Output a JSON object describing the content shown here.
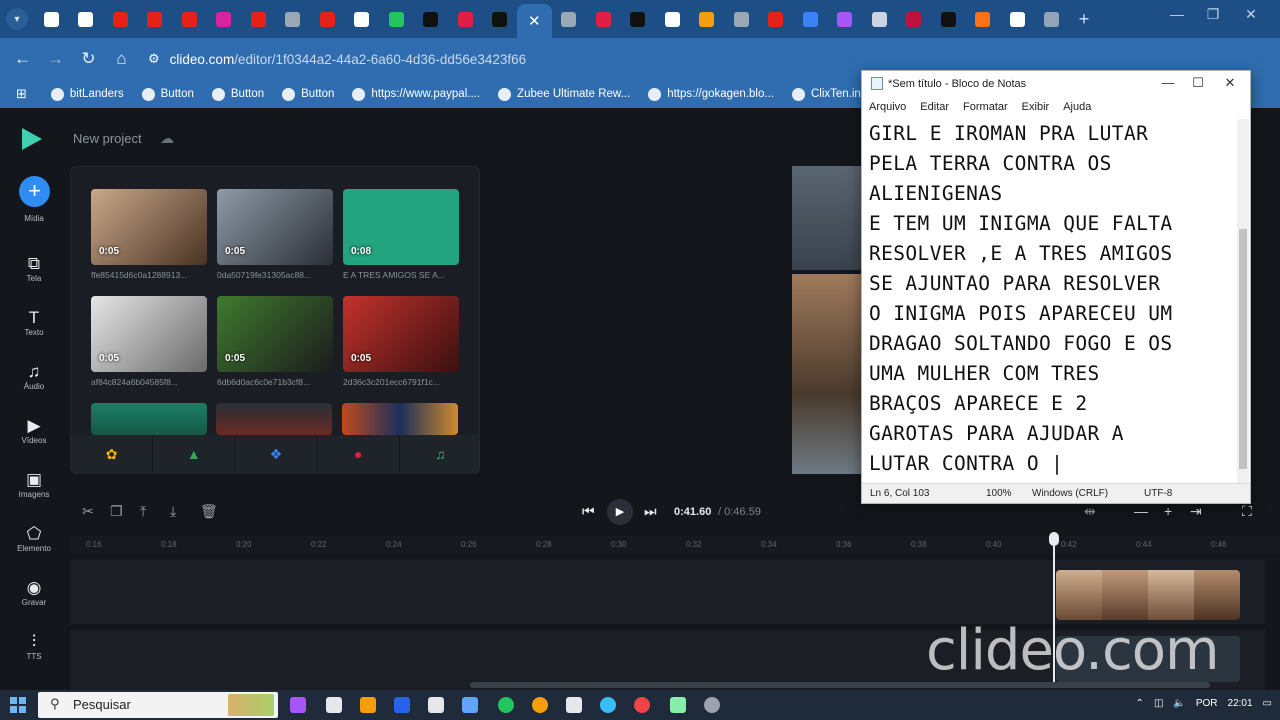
{
  "browser": {
    "tabs": [
      {
        "icon": "chrome-icon",
        "color": "#ffffff"
      },
      {
        "icon": "tab-icon-1",
        "color": "#ffffff"
      },
      {
        "icon": "youtube-icon",
        "color": "#e62117"
      },
      {
        "icon": "youtube-icon",
        "color": "#e62117"
      },
      {
        "icon": "youtube-icon",
        "color": "#e62117"
      },
      {
        "icon": "instagram-icon",
        "color": "#d6249f"
      },
      {
        "icon": "youtube-icon",
        "color": "#e62117"
      },
      {
        "icon": "tab-icon-7",
        "color": "#9aa7b5"
      },
      {
        "icon": "youtube-icon",
        "color": "#e62117"
      },
      {
        "icon": "capcut-icon",
        "color": "#ffffff"
      },
      {
        "icon": "tab-icon-10",
        "color": "#22c55e"
      },
      {
        "icon": "tab-icon-11",
        "color": "#111111"
      },
      {
        "icon": "tab-icon-12",
        "color": "#e11d48"
      },
      {
        "icon": "tiktok-icon",
        "color": "#111111"
      },
      {
        "icon": "close-icon",
        "color": "#ffffff"
      },
      {
        "icon": "tab-icon-15",
        "color": "#9aa7b5"
      },
      {
        "icon": "tab-icon-16",
        "color": "#e11d48"
      },
      {
        "icon": "tab-icon-17",
        "color": "#111111"
      },
      {
        "icon": "tab-icon-18",
        "color": "#ffffff"
      },
      {
        "icon": "tab-icon-19",
        "color": "#f59e0b"
      },
      {
        "icon": "cloud-icon",
        "color": "#9aa7b5"
      },
      {
        "icon": "youtube-icon",
        "color": "#e62117"
      },
      {
        "icon": "tab-icon-22",
        "color": "#3b82f6"
      },
      {
        "icon": "tab-icon-23",
        "color": "#a855f7"
      },
      {
        "icon": "speaker-icon",
        "color": "#cbd5e1"
      },
      {
        "icon": "tab-icon-25",
        "color": "#be123c"
      },
      {
        "icon": "tab-icon-26",
        "color": "#111111"
      },
      {
        "icon": "tab-icon-27",
        "color": "#f97316"
      },
      {
        "icon": "google-icon",
        "color": "#ffffff"
      },
      {
        "icon": "tab-icon-29",
        "color": "#94a3b8"
      }
    ],
    "new_tab": "+",
    "address": {
      "host": "clideo.com",
      "path": "/editor/1f0344a2-44a2-6a60-4d36-dd56e3423f66"
    },
    "bookmarks": [
      "bitLanders",
      "Button",
      "Button",
      "Button",
      "https://www.paypal....",
      "Zubee Ultimate Rew...",
      "https://gokagen.blo...",
      "ClixTen.in"
    ]
  },
  "editor": {
    "project_name": "New project",
    "sidebar": [
      {
        "label": "Mídia",
        "icon": "plus-icon"
      },
      {
        "label": "Tela",
        "icon": "screen-icon"
      },
      {
        "label": "Texto",
        "icon": "text-icon"
      },
      {
        "label": "Áudio",
        "icon": "music-icon"
      },
      {
        "label": "Vídeos",
        "icon": "video-icon"
      },
      {
        "label": "Imagens",
        "icon": "image-icon"
      },
      {
        "label": "Elemento",
        "icon": "shapes-icon"
      },
      {
        "label": "Gravar",
        "icon": "record-icon"
      },
      {
        "label": "TTS",
        "icon": "waveform-icon"
      }
    ],
    "media": [
      {
        "duration": "0:05",
        "caption": "ffe85415d6c0a1288913...",
        "colors": [
          "#c9a88b",
          "#4a3322"
        ]
      },
      {
        "duration": "0:05",
        "caption": "0da50719fe31305ac88...",
        "colors": [
          "#8e9aa6",
          "#2b2f36"
        ]
      },
      {
        "duration": "0:08",
        "caption": "E A TRES AMIGOS SE A...",
        "colors": [
          "#22a47e",
          "#22a47e"
        ]
      },
      {
        "duration": "0:05",
        "caption": "af84c824a6b04585f8...",
        "colors": [
          "#e6e6e6",
          "#6a6a6a"
        ]
      },
      {
        "duration": "0:05",
        "caption": "6db6d0ac6c0e71b3cf8...",
        "colors": [
          "#3f7a2e",
          "#1c1c1c"
        ]
      },
      {
        "duration": "0:05",
        "caption": "2d36c3c201ecc6791f1c...",
        "colors": [
          "#c2322c",
          "#3a1010"
        ]
      }
    ],
    "timeline": {
      "current_time": "0:41.60",
      "total_time": "/ 0:46.59",
      "ticks": [
        "0:16",
        "0:18",
        "0:20",
        "0:22",
        "0:24",
        "0:26",
        "0:28",
        "0:30",
        "0:32",
        "0:34",
        "0:36",
        "0:38",
        "0:40",
        "0:42",
        "0:44",
        "0:46"
      ]
    },
    "watermark": "clideo.com"
  },
  "notepad": {
    "title": "*Sem título - Bloco de Notas",
    "menu": [
      "Arquivo",
      "Editar",
      "Formatar",
      "Exibir",
      "Ajuda"
    ],
    "text": "GIRL E IROMAN PRA LUTAR\nPELA TERRA CONTRA OS\nALIENIGENAS\nE TEM UM INIGMA QUE FALTA\nRESOLVER ,E A TRES AMIGOS\nSE AJUNTAO PARA RESOLVER\nO INIGMA POIS APARECEU UM\nDRAGAO SOLTANDO FOGO E OS\nUMA MULHER COM TRES\nBRAÇOS APARECE E 2\nGAROTAS PARA AJUDAR A\nLUTAR CONTRA O |",
    "status": {
      "position": "Ln 6, Col 103",
      "zoom": "100%",
      "line_ending": "Windows (CRLF)",
      "encoding": "UTF-8"
    }
  },
  "taskbar": {
    "search_placeholder": "Pesquisar",
    "language": "POR",
    "time": "22:01"
  }
}
